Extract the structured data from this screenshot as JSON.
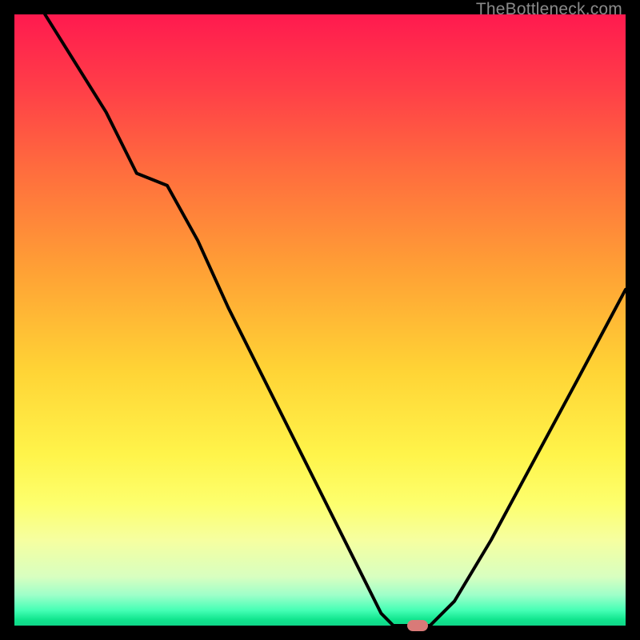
{
  "watermark": "TheBottleneck.com",
  "chart_data": {
    "type": "line",
    "title": "",
    "xlabel": "",
    "ylabel": "",
    "xlim": [
      0,
      100
    ],
    "ylim": [
      0,
      100
    ],
    "series": [
      {
        "name": "curve",
        "x": [
          5,
          10,
          15,
          20,
          25,
          30,
          35,
          40,
          45,
          50,
          55,
          60,
          62,
          65,
          68,
          72,
          78,
          85,
          92,
          100
        ],
        "y": [
          100,
          92,
          84,
          74,
          72,
          63,
          52,
          42,
          32,
          22,
          12,
          2,
          0,
          0,
          0,
          4,
          14,
          27,
          40,
          55
        ]
      }
    ],
    "marker": {
      "x": 66,
      "y": 0,
      "color": "#d97a78"
    },
    "gradient_stops": [
      {
        "pos": 0,
        "color": "#ff1a4f"
      },
      {
        "pos": 0.72,
        "color": "#fff44a"
      },
      {
        "pos": 1.0,
        "color": "#0fd688"
      }
    ]
  },
  "colors": {
    "frame": "#000000",
    "curve": "#000000",
    "marker": "#d97a78",
    "watermark": "#8a8a8a"
  }
}
